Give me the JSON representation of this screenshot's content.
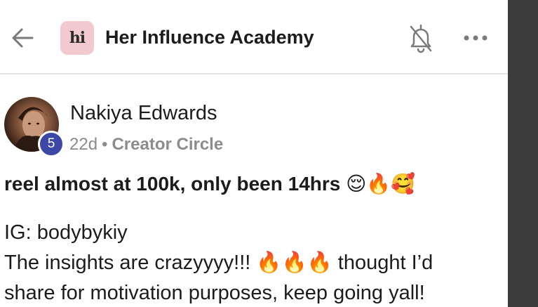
{
  "header": {
    "group_logo_text": "hi",
    "group_name": "Her Influence Academy",
    "back_icon": "arrow-left-icon",
    "bell_icon": "bell-slash-icon",
    "more_icon": "more-horizontal-icon"
  },
  "post": {
    "author": "Nakiya Edwards",
    "level": "5",
    "age": "22d",
    "separator": "•",
    "category": "Creator Circle",
    "title": "reel almost at 100k, only been 14hrs 😌🔥🥰",
    "body_lines": [
      "IG: bodybykiy",
      "The insights are crazyyyy!!! 🔥🔥🔥 thought I’d",
      "share for motivation purposes, keep going yall!"
    ]
  },
  "colors": {
    "badge": "#3d47a8",
    "logo_bg": "#f2c9cf",
    "meta_text": "#8c8c8c",
    "divider": "#e4e4e4"
  }
}
